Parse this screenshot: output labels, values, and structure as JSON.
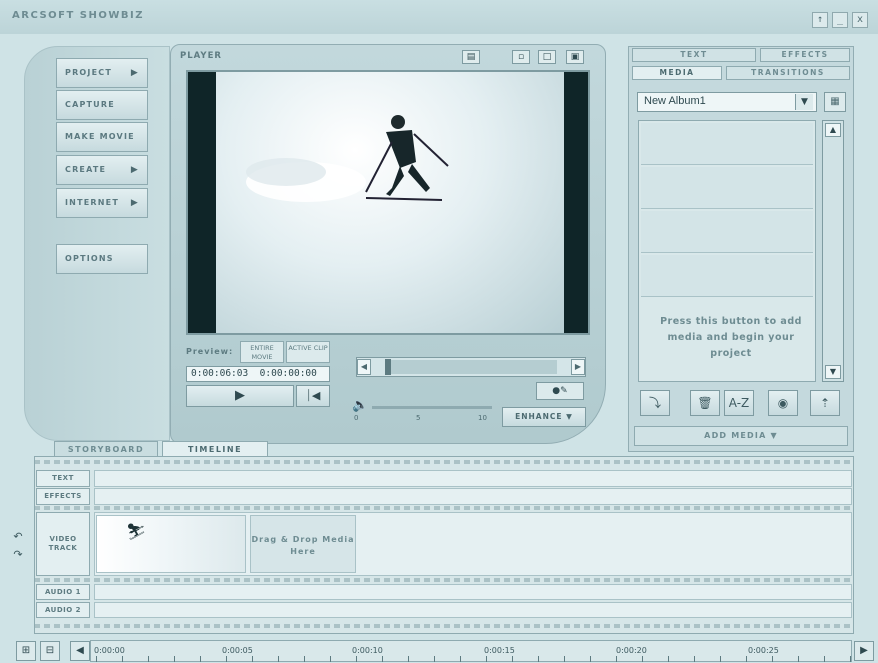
{
  "app": {
    "title": "ArcSoft ShowBiz"
  },
  "window_controls": [
    "↑",
    "_",
    "x"
  ],
  "nav": {
    "project": "Project",
    "capture": "Capture",
    "make_movie": "Make Movie",
    "create": "Create",
    "internet": "Internet",
    "options": "Options"
  },
  "player": {
    "label": "Player",
    "preview_label": "Preview:",
    "entire_movie": "Entire Movie",
    "active_clip": "Active Clip",
    "timecode_current": "0:00:06:03",
    "timecode_total": "0:00:00:00",
    "volume_ticks": [
      "0",
      "5",
      "10"
    ],
    "enhance": "Enhance"
  },
  "media": {
    "tabs": {
      "text": "Text",
      "effects": "Effects",
      "media": "Media",
      "transitions": "Transitions"
    },
    "album": "New Album1",
    "hint": "Press this button to add media and begin your project",
    "add_media": "Add Media",
    "sort_label": "A-Z"
  },
  "bottom_tabs": {
    "storyboard": "Storyboard",
    "timeline": "Timeline"
  },
  "tracks": {
    "text": "Text",
    "effects": "Effects",
    "video_track": "Video Track",
    "audio1": "Audio 1",
    "audio2": "Audio 2"
  },
  "timeline": {
    "drop_hint": "Drag & Drop Media Here"
  },
  "ruler": {
    "labels": [
      "0:00:00",
      "0:00:05",
      "0:00:10",
      "0:00:15",
      "0:00:20",
      "0:00:25"
    ]
  },
  "icons": {
    "play": "play-icon",
    "end": "skip-end-icon",
    "volume": "speaker-icon",
    "split": "split-icon"
  }
}
